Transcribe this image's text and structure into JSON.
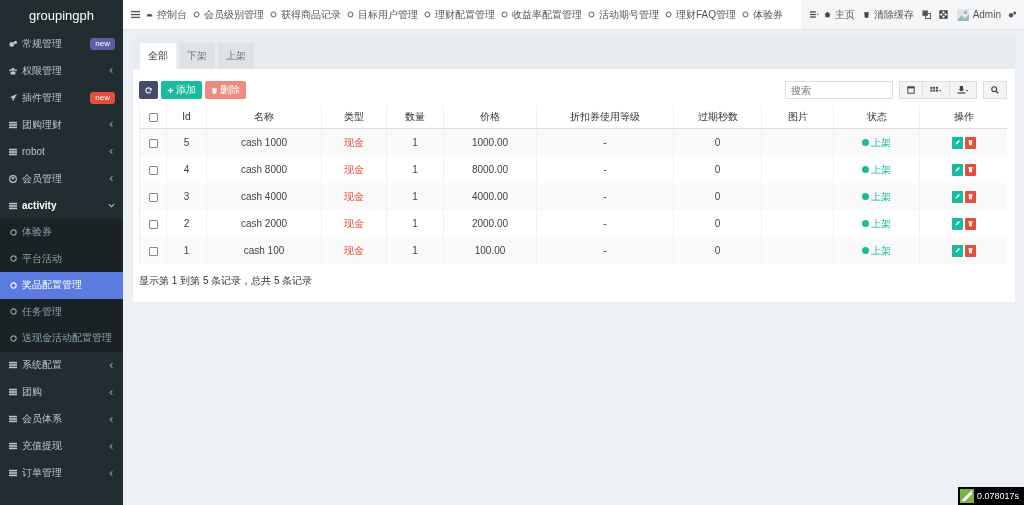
{
  "brand": "groupingph",
  "sidebar": {
    "items": [
      {
        "label": "常规管理",
        "badge": {
          "text": "new",
          "color": "#605ca8"
        }
      },
      {
        "label": "权限管理",
        "expanded": false
      },
      {
        "label": "插件管理",
        "badge": {
          "text": "new",
          "color": "#e74c3c"
        }
      },
      {
        "label": "团购理财",
        "expanded": false
      },
      {
        "label": "robot",
        "expanded": false
      },
      {
        "label": "会员管理",
        "expanded": false
      },
      {
        "label": "activity",
        "expanded": true,
        "children": [
          {
            "label": "体验券",
            "selected": false
          },
          {
            "label": "平台活动",
            "selected": false
          },
          {
            "label": "奖品配置管理",
            "selected": true
          },
          {
            "label": "任务管理",
            "selected": false
          },
          {
            "label": "送现金活动配置管理",
            "selected": false
          }
        ]
      },
      {
        "label": "系统配置",
        "expanded": false
      },
      {
        "label": "团购",
        "expanded": false
      },
      {
        "label": "会员体系",
        "expanded": false
      },
      {
        "label": "充值提现",
        "expanded": false
      },
      {
        "label": "订单管理",
        "expanded": false
      }
    ]
  },
  "nav": [
    "控制台",
    "会员级别管理",
    "获得商品记录",
    "目标用户管理",
    "理财配置管理",
    "收益率配置管理",
    "活动期号管理",
    "理财FAQ管理",
    "体验券"
  ],
  "header_right": {
    "home": "主页",
    "clear_cache": "清除缓存",
    "user": "Admin"
  },
  "tabs": [
    {
      "label": "全部",
      "selected": true
    },
    {
      "label": "下架",
      "selected": false
    },
    {
      "label": "上架",
      "selected": false
    }
  ],
  "toolbar": {
    "add": "添加",
    "delete": {
      "label": "删除",
      "disabled": true
    },
    "search": {
      "placeholder": "搜索"
    }
  },
  "table": {
    "select_all": {
      "checked": false
    },
    "columns": [
      "Id",
      "名称",
      "类型",
      "数量",
      "价格",
      "折扣券使用等级",
      "过期秒数",
      "图片",
      "状态",
      "操作"
    ],
    "rows": [
      {
        "checked": false,
        "id": "5",
        "name": "cash 1000",
        "type": "现金",
        "quantity": "1",
        "price": "1000.00",
        "discount": "-",
        "expire": "0",
        "status": {
          "text": "上架",
          "color": "#18bc9c"
        }
      },
      {
        "checked": false,
        "id": "4",
        "name": "cash 8000",
        "type": "现金",
        "quantity": "1",
        "price": "8000.00",
        "discount": "-",
        "expire": "0",
        "status": {
          "text": "上架",
          "color": "#18bc9c"
        }
      },
      {
        "checked": false,
        "id": "3",
        "name": "cash 4000",
        "type": "现金",
        "quantity": "1",
        "price": "4000.00",
        "discount": "-",
        "expire": "0",
        "status": {
          "text": "上架",
          "color": "#18bc9c"
        }
      },
      {
        "checked": false,
        "id": "2",
        "name": "cash 2000",
        "type": "现金",
        "quantity": "1",
        "price": "2000.00",
        "discount": "-",
        "expire": "0",
        "status": {
          "text": "上架",
          "color": "#18bc9c"
        }
      },
      {
        "checked": false,
        "id": "1",
        "name": "cash 100",
        "type": "现金",
        "quantity": "1",
        "price": "100.00",
        "discount": "-",
        "expire": "0",
        "status": {
          "text": "上架",
          "color": "#18bc9c"
        }
      }
    ]
  },
  "pagination_info": "显示第 1 到第 5 条记录，总共 5 条记录",
  "timer": "0.078017s"
}
